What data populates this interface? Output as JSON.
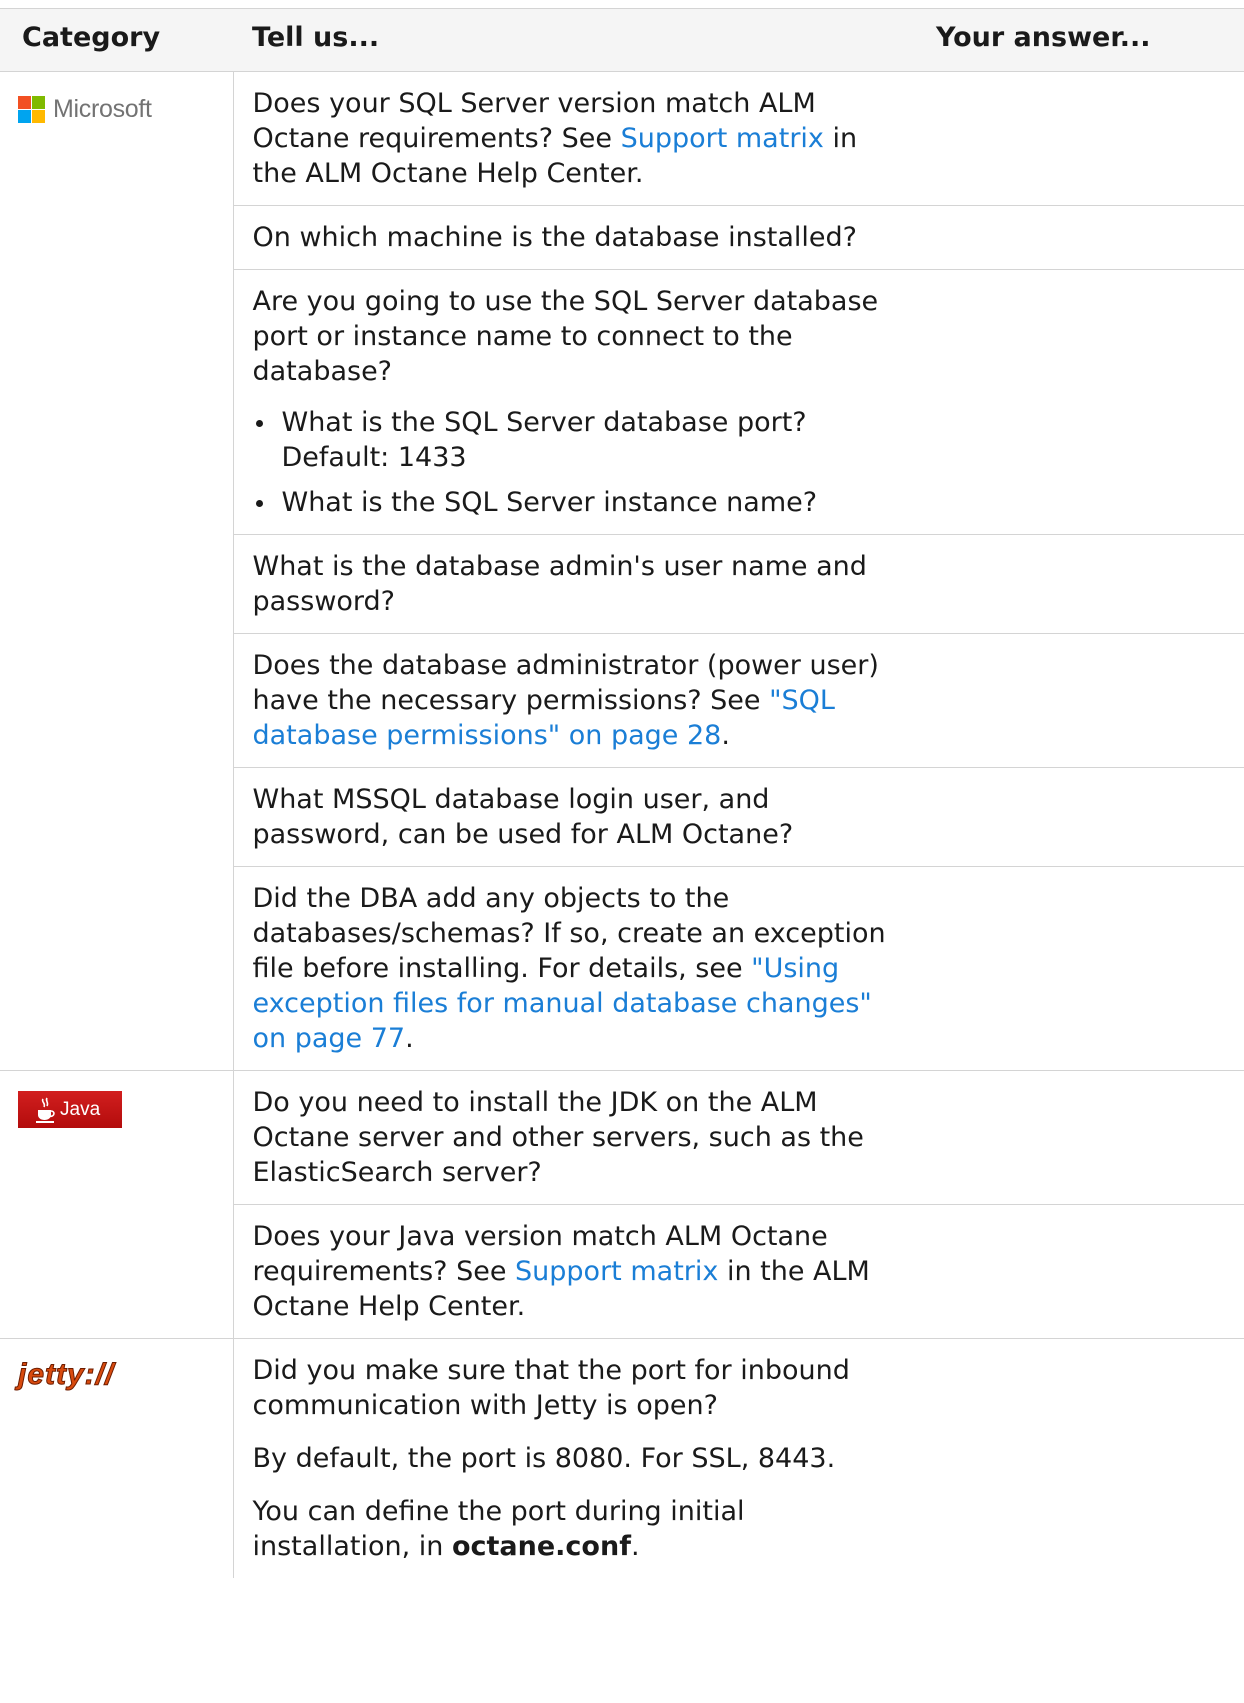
{
  "header": {
    "category": "Category",
    "tell_us": "Tell us...",
    "answer": "Your answer..."
  },
  "categories": {
    "microsoft": {
      "logo_text": "Microsoft",
      "colors": [
        "#f25022",
        "#7fba00",
        "#00a4ef",
        "#ffb900"
      ]
    },
    "java": {
      "logo_text": "Java",
      "color": "#c4161c"
    },
    "jetty": {
      "logo_text": "jetty://",
      "color": "#d84a0e"
    }
  },
  "rows": {
    "ms1": {
      "pre": "Does your SQL Server version match ALM Octane requirements? See ",
      "link": "Support matrix",
      "post": " in the ALM Octane Help Center."
    },
    "ms2": {
      "text": "On which machine is the database installed?"
    },
    "ms3": {
      "text": "Are you going to use the SQL Server database port or instance name to connect to the database?",
      "bullets": [
        "What is the SQL Server database port? Default: 1433",
        "What is the SQL Server instance name?"
      ]
    },
    "ms4": {
      "text": "What is the database admin's user name and password?"
    },
    "ms5": {
      "pre": "Does the database administrator (power user) have the necessary permissions? See ",
      "link": "\"SQL database permissions\" on page 28",
      "post": "."
    },
    "ms6": {
      "text": "What MSSQL database login user, and password, can be used for ALM Octane?"
    },
    "ms7": {
      "pre": "Did the DBA add any objects to the databases/schemas? If so, create an exception file before installing. For details, see ",
      "link": "\"Using exception files for manual database changes\" on page 77",
      "post": "."
    },
    "java1": {
      "text": "Do you need to install the JDK on the ALM Octane server and other servers, such as the ElasticSearch server?"
    },
    "java2": {
      "pre": "Does your Java version match ALM Octane requirements? See ",
      "link": "Support matrix",
      "post": " in the ALM Octane Help Center."
    },
    "jetty1": {
      "p1": "Did you make sure that the port for inbound communication with Jetty is open?",
      "p2": "By default, the port is 8080. For SSL, 8443.",
      "p3_pre": "You can define the port during initial installation, in ",
      "p3_bold": "octane.conf",
      "p3_post": "."
    }
  },
  "colors": {
    "link": "#1a7ed6",
    "border": "#d4d4d4",
    "header_bg": "#f5f5f5"
  }
}
